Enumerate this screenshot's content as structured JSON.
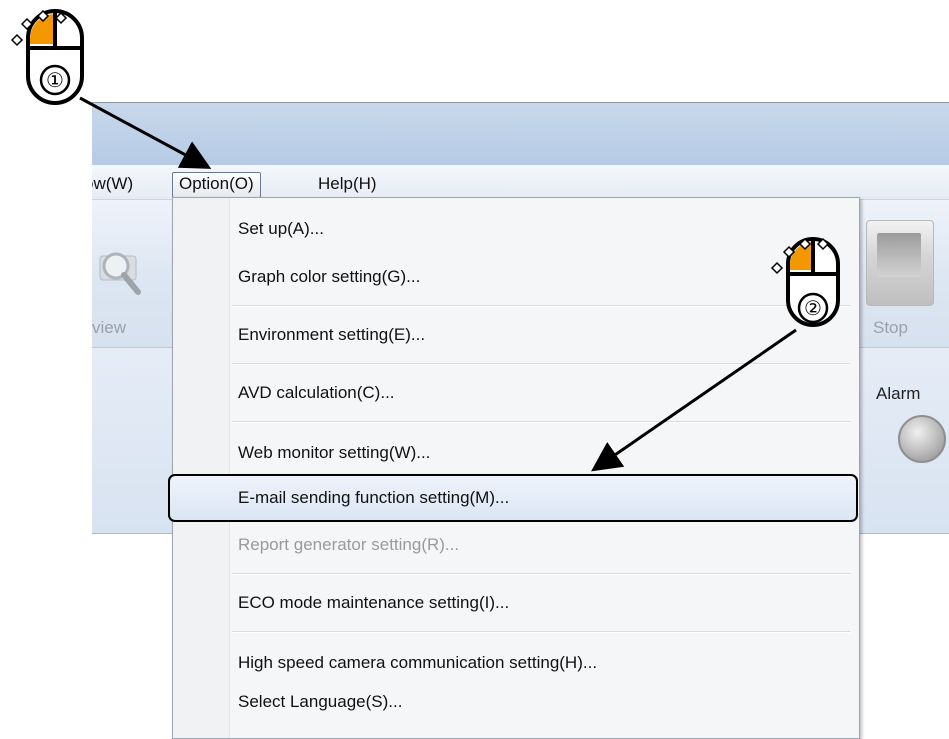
{
  "menu_bar": {
    "window_partial": "ow(W)",
    "option": "Option(O)",
    "help": "Help(H)"
  },
  "toolbar": {
    "preview_partial": "view",
    "stop_label": "Stop",
    "alarm_label": "Alarm"
  },
  "option_menu": {
    "items": [
      {
        "label": "Set up(A)...",
        "enabled": true
      },
      {
        "label": "Graph color setting(G)...",
        "enabled": true
      },
      {
        "label": "Environment setting(E)...",
        "enabled": true
      },
      {
        "label": "AVD calculation(C)...",
        "enabled": true
      },
      {
        "label": "Web monitor setting(W)...",
        "enabled": true
      },
      {
        "label": "E-mail sending function setting(M)...",
        "enabled": true,
        "highlighted": true
      },
      {
        "label": "Report generator setting(R)...",
        "enabled": false
      },
      {
        "label": "ECO mode maintenance setting(I)...",
        "enabled": true
      },
      {
        "label": "High speed camera communication setting(H)...",
        "enabled": true
      },
      {
        "label": "Select Language(S)...",
        "enabled": true
      }
    ]
  },
  "annotations": {
    "step1": "①",
    "step2": "②",
    "mouse_color": "#f39800"
  },
  "colors": {
    "title_bar": "#bcd0e8",
    "menu_highlight_border": "#000000"
  }
}
